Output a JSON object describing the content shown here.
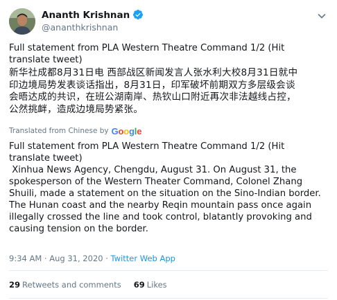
{
  "author": {
    "display_name": "Ananth Krishnan",
    "handle": "@ananthkrishnan"
  },
  "tweet": {
    "english_intro": "Full statement from PLA Western Theatre Command 1/2 (Hit\ntranslate tweet)",
    "chinese_text": "新华社成都8月31日电 西部战区新闻发言人张水利大校8月31日就中\n印边境局势发表谈话指出，8月31日，印军破坏前期双方多层级会谈\n会晤达成的共识，在班公湖南岸、热钦山口附近再次非法越线占控，\n公然挑衅，造成边境局势紧张。",
    "translated_label": "Translated from Chinese by",
    "translated_text": "Full statement from PLA Western Theatre Command 1/2 (Hit\ntranslate tweet)\n Xinhua News Agency, Chengdu, August 31. On August 31, the\nspokesperson of the Western Theater Command, Colonel Zhang\nShuili, made a statement on the situation on the Sino-Indian border.\nThe Hunan coast and the nearby Reqin mountain pass once again\nillegally crossed the line and took control, blatantly provoking and\ncausing tension on the border."
  },
  "meta": {
    "time": "9:34 AM",
    "separator": " · ",
    "date": "Aug 31, 2020",
    "source": "Twitter Web App"
  },
  "stats": {
    "retweets_count": "29",
    "retweets_label": "Retweets and comments",
    "likes_count": "69",
    "likes_label": "Likes"
  },
  "icons": {
    "verified": "verified-badge-icon",
    "menu": "chevron-down-icon",
    "google": "google-logo"
  },
  "colors": {
    "accent": "#1da1f2",
    "secondary_text": "#657786",
    "divider": "#e6ecf0"
  }
}
